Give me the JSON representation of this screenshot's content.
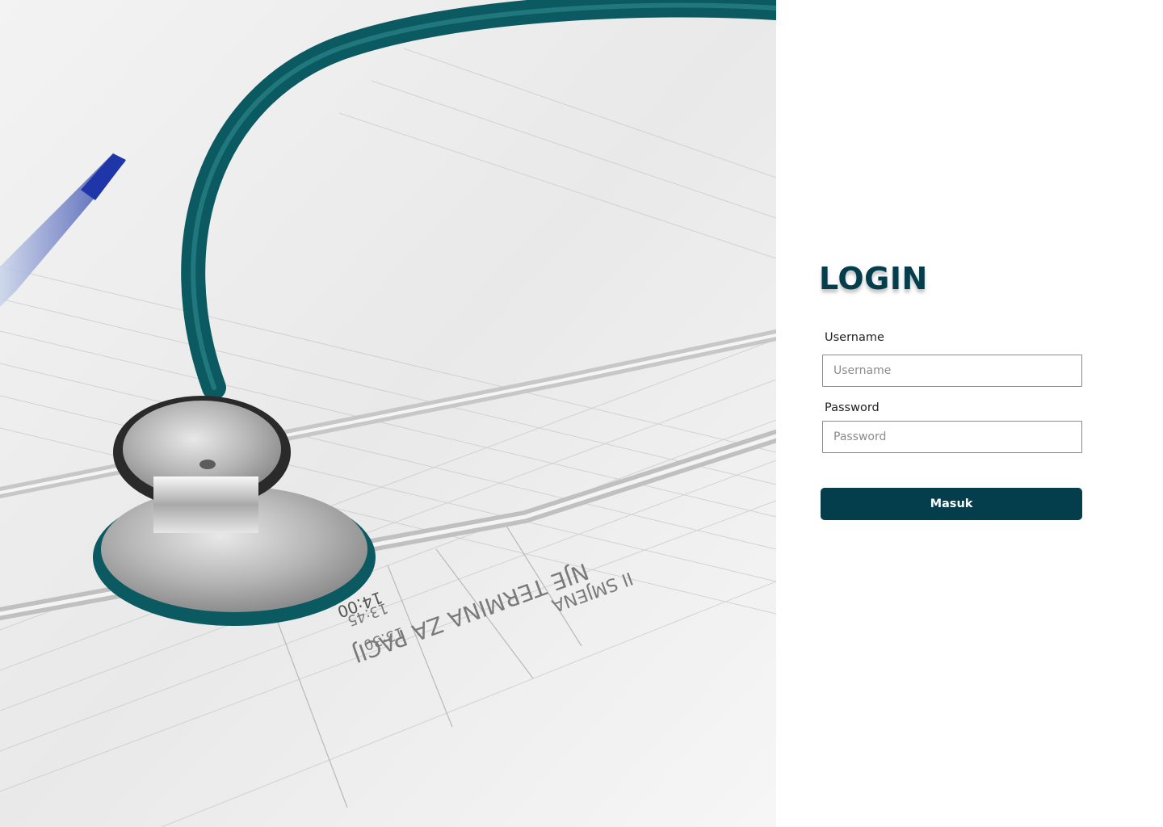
{
  "login": {
    "title": "LOGIN",
    "username_label": "Username",
    "username_placeholder": "Username",
    "password_label": "Password",
    "password_placeholder": "Password",
    "submit_label": "Masuk"
  },
  "colors": {
    "primary": "#043e4c",
    "stethoscope_tube": "#0d5f66"
  },
  "hero_image": {
    "subject": "stethoscope-on-medical-form"
  }
}
